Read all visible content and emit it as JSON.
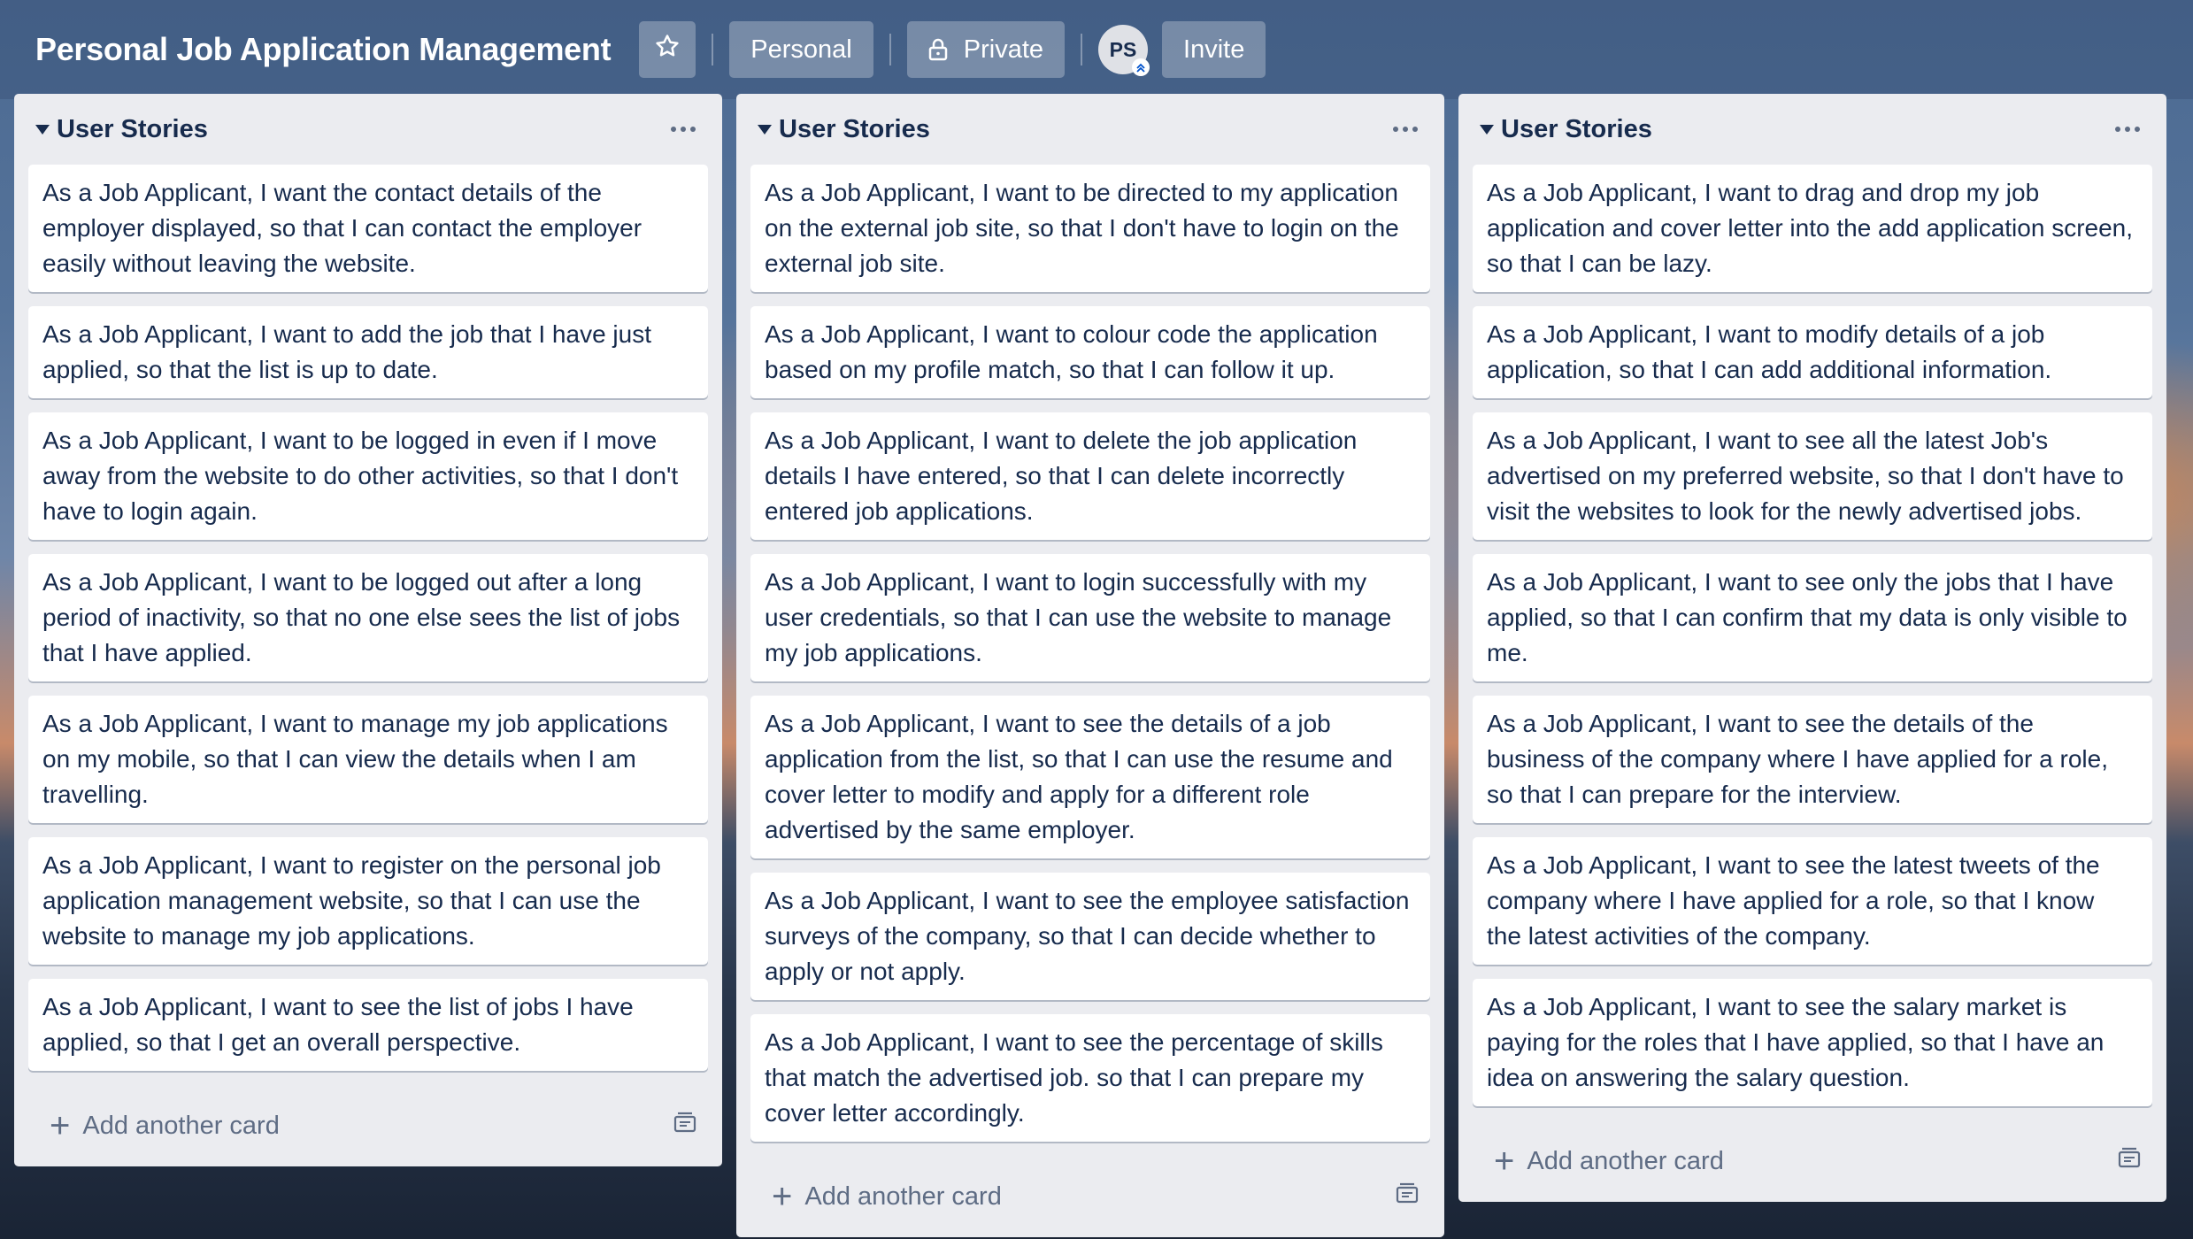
{
  "header": {
    "title": "Personal Job Application Management",
    "personal_label": "Personal",
    "private_label": "Private",
    "avatar_initials": "PS",
    "invite_label": "Invite"
  },
  "add_card_label": "Add another card",
  "lists": [
    {
      "title": "User Stories",
      "cards": [
        "As a Job Applicant, I want the contact details of the employer displayed, so that I can contact the employer easily without leaving the website.",
        "As a Job Applicant, I want to add the job that I have just applied, so that the list is up to date.",
        "As a Job Applicant, I want to be logged in even if I move away from the website to do other activities, so that I don't have to login again.",
        "As a Job Applicant, I want to be logged out after a long period of inactivity, so that no one else sees the list of jobs that I have applied.",
        "As a Job Applicant, I want to manage my job applications on my mobile, so that I can view the details when I am travelling.",
        "As a Job Applicant, I want to register on the personal job application management website, so that I can use the website to manage my job applications.",
        "As a Job Applicant, I want to see the list of jobs I have applied, so that I get an overall perspective."
      ]
    },
    {
      "title": "User Stories",
      "cards": [
        "As a Job Applicant, I want to be directed to my application on the external job site, so that I don't have to login on the external job site.",
        "As a Job Applicant, I want to colour code the application based on my profile match, so that I can follow it up.",
        "As a Job Applicant, I want to delete the job application details I have entered, so that I can delete incorrectly entered job applications.",
        "As a Job Applicant, I want to login successfully with my user credentials, so that I can use the website to manage my job applications.",
        "As a Job Applicant, I want to see the details of a job application from the list, so that I can use the resume and cover letter to modify and apply for a different role advertised by the same employer.",
        "As a Job Applicant, I want to see the employee satisfaction surveys of the company, so that I can decide whether to apply or not apply.",
        "As a Job Applicant, I want to see the percentage of skills that match the advertised job. so that I can prepare my cover letter accordingly."
      ]
    },
    {
      "title": "User Stories",
      "cards": [
        "As a Job Applicant, I want to drag and drop my job application and cover letter into the add application screen, so that I can be lazy.",
        "As a Job Applicant, I want to modify details of a job application, so that I can add additional information.",
        "As a Job Applicant, I want to see all the latest Job's advertised on my preferred website, so that I don't have to visit the websites to look for the newly advertised jobs.",
        "As a Job Applicant, I want to see only the jobs that I have applied, so that I can confirm that my data is only visible to me.",
        "As a Job Applicant, I want to see the details of the business of the company where I have applied for a role, so that I can prepare for the interview.",
        "As a Job Applicant, I want to see the latest tweets of the company where I have applied for a role, so that I know the latest activities of the company.",
        "As a Job Applicant, I want to see the salary market is paying for the roles that I have applied, so that I have an idea on answering the salary question."
      ]
    }
  ]
}
